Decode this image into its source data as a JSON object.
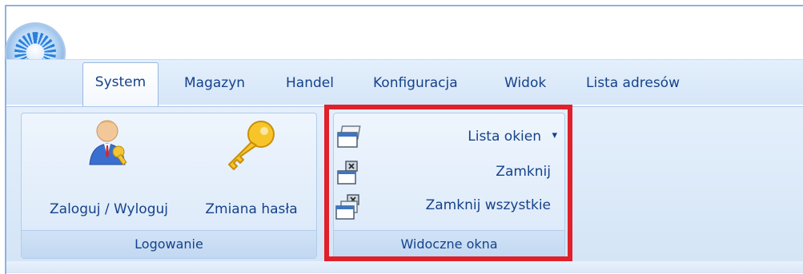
{
  "tabs": [
    {
      "label": "System",
      "active": true
    },
    {
      "label": "Magazyn"
    },
    {
      "label": "Handel"
    },
    {
      "label": "Konfiguracja"
    },
    {
      "label": "Widok"
    },
    {
      "label": "Lista adresów"
    }
  ],
  "groups": {
    "logowanie": {
      "title": "Logowanie",
      "buttons": [
        {
          "label": "Zaloguj / Wyloguj",
          "icon": "user-key-icon"
        },
        {
          "label": "Zmiana hasła",
          "icon": "key-icon"
        }
      ]
    },
    "widoczne_okna": {
      "title": "Widoczne okna",
      "buttons": [
        {
          "label": "Lista okien",
          "icon": "window-list-icon",
          "dropdown": true
        },
        {
          "label": "Zamknij",
          "icon": "close-window-icon"
        },
        {
          "label": "Zamknij wszystkie",
          "icon": "close-all-windows-icon"
        }
      ]
    }
  },
  "dropdown_glyph": "▾",
  "colors": {
    "ribbon_text": "#15428b",
    "highlight": "#e0202a"
  }
}
